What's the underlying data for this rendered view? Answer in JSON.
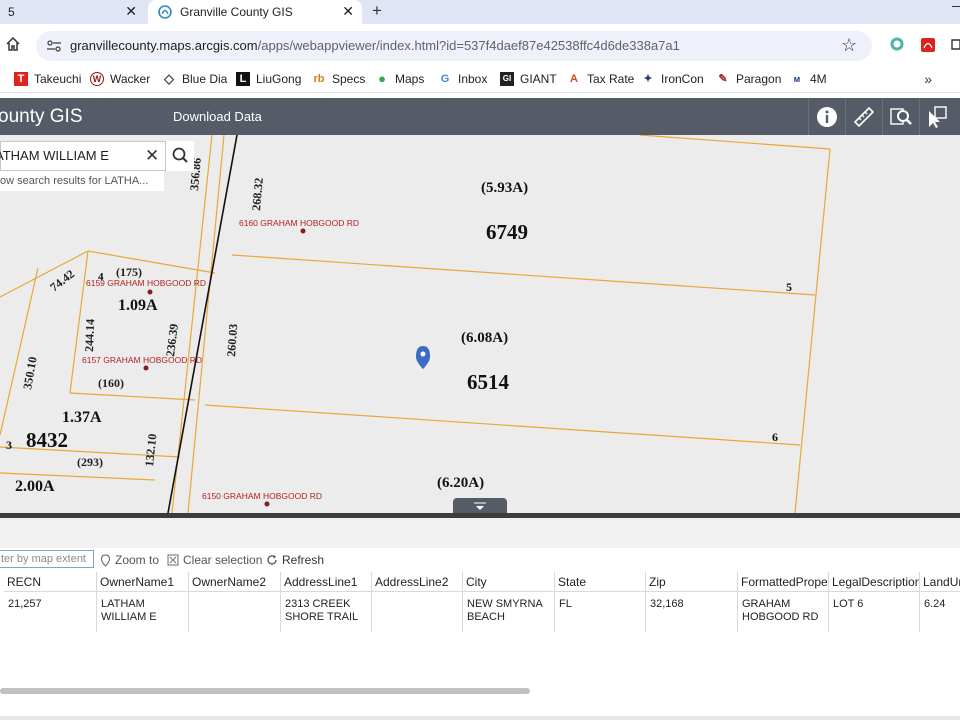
{
  "browser": {
    "tabs": [
      {
        "title": "5",
        "active": false
      },
      {
        "title": "Granville County GIS",
        "active": true
      }
    ],
    "url_host": "granvillecounty.maps.arcgis.com",
    "url_path": "/apps/webappviewer/index.html?id=537f4daef87e42538ffc4d6de338a7a1",
    "bookmarks": [
      {
        "label": "Takeuchi",
        "icon": "takeuchi-icon",
        "color": "#e2231a"
      },
      {
        "label": "Wacker",
        "icon": "wacker-icon",
        "color": "#8b1a1a"
      },
      {
        "label": "Blue Dia",
        "icon": "diamond-icon",
        "color": "#444"
      },
      {
        "label": "LiuGong",
        "icon": "liugong-icon",
        "color": "#111"
      },
      {
        "label": "Specs",
        "icon": "rb-icon",
        "color": "#c8841c"
      },
      {
        "label": "Maps",
        "icon": "maps-icon",
        "color": "#34a853"
      },
      {
        "label": "Inbox",
        "icon": "google-icon",
        "color": "#4285f4"
      },
      {
        "label": "GIANT",
        "icon": "giant-icon",
        "color": "#222"
      },
      {
        "label": "Tax Rate",
        "icon": "tax-icon",
        "color": "#d24b1a"
      },
      {
        "label": "IronCon",
        "icon": "ironcon-icon",
        "color": "#2a3a6a"
      },
      {
        "label": "Paragon",
        "icon": "paragon-icon",
        "color": "#b02a2a"
      },
      {
        "label": "4M",
        "icon": "4m-icon",
        "color": "#1a3f8a"
      }
    ]
  },
  "app": {
    "title": "ounty GIS",
    "download_label": "Download Data",
    "header_color": "#555b67"
  },
  "search": {
    "value": "ATHAM WILLIAM E",
    "suggestion": "ow search results for LATHA..."
  },
  "map": {
    "acreage_labels": [
      "(5.93A)",
      "(6.08A)",
      "(6.20A)",
      "1.09A",
      "1.37A",
      "2.00A"
    ],
    "parcel_numbers": [
      "6749",
      "6514",
      "8432"
    ],
    "lot_numbers": [
      "5",
      "6",
      "3",
      "4"
    ],
    "addresses": [
      "6160 GRAHAM HOBGOOD RD",
      "6159 GRAHAM HOBGOOD RD",
      "6157 GRAHAM HOBGOOD RD",
      "6150 GRAHAM HOBGOOD RD"
    ],
    "dimensions": [
      "356.86",
      "268.32",
      "74.42",
      "(175)",
      "244.14",
      "236.39",
      "260.03",
      "350.10",
      "(160)",
      "132.10",
      "(293)"
    ],
    "parcel_line_color": "#e8a838",
    "address_color": "#b22222",
    "pin_color": "#3b6cc4"
  },
  "table_toolbar": {
    "filter_placeholder": "ter by map extent",
    "zoom_label": "Zoom to",
    "clear_label": "Clear selection",
    "refresh_label": "Refresh"
  },
  "table": {
    "columns": [
      "RECN",
      "OwnerName1",
      "OwnerName2",
      "AddressLine1",
      "AddressLine2",
      "City",
      "State",
      "Zip",
      "FormattedPropert",
      "LegalDescription",
      "LandUr"
    ],
    "row": [
      "21,257",
      "LATHAM WILLIAM E",
      "",
      "2313 CREEK SHORE TRAIL",
      "",
      "NEW SMYRNA BEACH",
      "FL",
      "32,168",
      "GRAHAM HOBGOOD RD",
      "LOT 6",
      "6.24"
    ]
  }
}
